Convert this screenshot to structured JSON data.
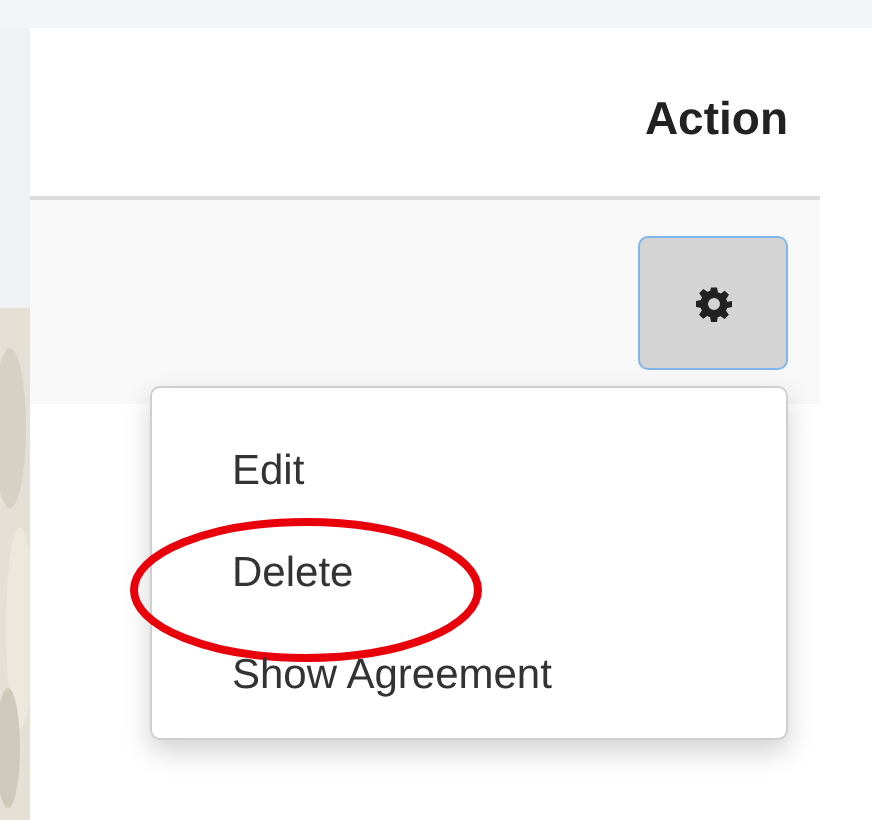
{
  "table": {
    "columns": [
      {
        "label": "Action"
      }
    ]
  },
  "action_menu": {
    "expanded": true,
    "items": [
      {
        "label": "Edit",
        "highlighted": false
      },
      {
        "label": "Delete",
        "highlighted": true
      },
      {
        "label": "Show Agreement",
        "highlighted": false
      }
    ]
  }
}
